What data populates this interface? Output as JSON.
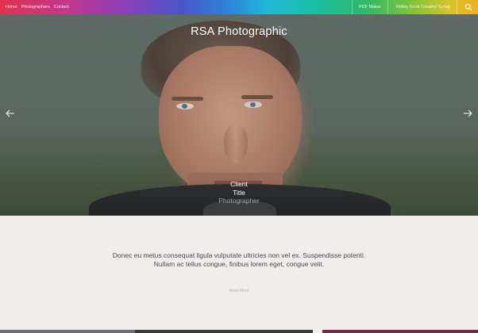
{
  "nav": {
    "links": [
      "Home",
      "Photographers",
      "Contact"
    ],
    "pdf_maker": "PDF Maker",
    "group": "Ridley Scott Creative Group",
    "search_icon": "search-icon"
  },
  "hero": {
    "title": "RSA Photographic",
    "caption": {
      "client": "Client",
      "title": "Title",
      "photographer": "Photographer"
    },
    "prev_icon": "arrow-left-icon",
    "next_icon": "arrow-right-icon"
  },
  "intro": {
    "line1": "Donec eu metus consequat ligula vulputate ultricies non vel ex. Suspendisse potenti.",
    "line2": "Nullam ac tellus congue, finibus lorem eget, congue velit.",
    "read_more": "Read More"
  },
  "colors": {
    "background": "#f0eeea",
    "intro_text": "#4a4a52",
    "nav_gradient": [
      "#e0324e",
      "#8a3fb8",
      "#2a86d8",
      "#1bbfa2",
      "#7cc43a",
      "#f0b020"
    ]
  }
}
